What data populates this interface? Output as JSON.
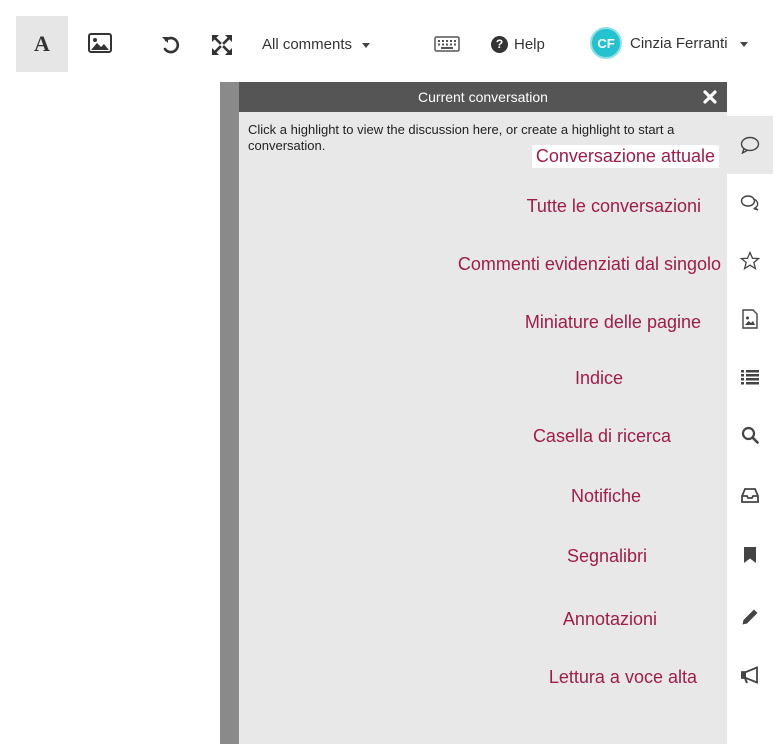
{
  "toolbar": {
    "text_mode_glyph": "A",
    "comments_dropdown": {
      "label": "All comments"
    },
    "help_label": "Help",
    "user": {
      "initials": "CF",
      "name": "Cinzia Ferranti"
    },
    "icons": {
      "image_mode": "image-icon",
      "undo": "undo-icon",
      "fullscreen": "expand-icon",
      "keyboard": "keyboard-icon",
      "help": "help-circle-icon"
    }
  },
  "panel": {
    "title": "Current conversation",
    "hint": "Click a highlight to view the discussion here, or create a highlight to start a conversation."
  },
  "rail": {
    "items": [
      {
        "icon": "comment-bubble-icon",
        "label": "Conversazione attuale"
      },
      {
        "icon": "comments-icon",
        "label": "Tutte le conversazioni"
      },
      {
        "icon": "star-icon",
        "label": "Commenti evidenziati dal singolo"
      },
      {
        "icon": "page-thumbnail-icon",
        "label": "Miniature delle pagine"
      },
      {
        "icon": "list-icon",
        "label": "Indice"
      },
      {
        "icon": "search-icon",
        "label": "Casella di ricerca"
      },
      {
        "icon": "inbox-icon",
        "label": "Notifiche"
      },
      {
        "icon": "bookmark-icon",
        "label": "Segnalibri"
      },
      {
        "icon": "pencil-icon",
        "label": "Annotazioni"
      },
      {
        "icon": "megaphone-icon",
        "label": "Lettura a voce alta"
      }
    ]
  },
  "colors": {
    "callout_text": "#a01d47",
    "panel_header": "#555555",
    "panel_body": "#e8e8e8",
    "avatar": "#22c3cf"
  }
}
